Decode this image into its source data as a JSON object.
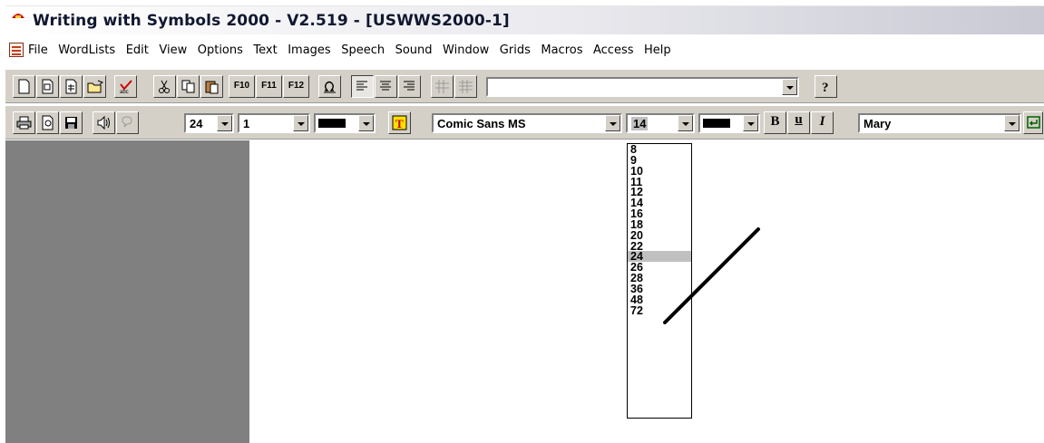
{
  "window": {
    "title": "Writing with Symbols 2000 -  V2.519 - [USWWS2000-1]"
  },
  "menu": {
    "items": [
      "File",
      "WordLists",
      "Edit",
      "View",
      "Options",
      "Text",
      "Images",
      "Speech",
      "Sound",
      "Window",
      "Grids",
      "Macros",
      "Access",
      "Help"
    ]
  },
  "toolbar1": {
    "function_keys": [
      "F10",
      "F11",
      "F12"
    ],
    "combo_value": ""
  },
  "toolbar2": {
    "symbol_size": "24",
    "line_value": "1",
    "font_name": "Comic Sans MS",
    "font_size": "14",
    "bold_label": "B",
    "underline_label": "u",
    "italic_label": "I",
    "voice": "Mary"
  },
  "font_size_dropdown": {
    "options": [
      "8",
      "9",
      "10",
      "11",
      "12",
      "14",
      "16",
      "18",
      "20",
      "22",
      "24",
      "26",
      "28",
      "36",
      "48",
      "72"
    ],
    "highlighted": "24"
  },
  "colors": {
    "toolbar_bg": "#d4d0c8",
    "side_panel": "#808080",
    "highlight": "#c0c0c0"
  }
}
